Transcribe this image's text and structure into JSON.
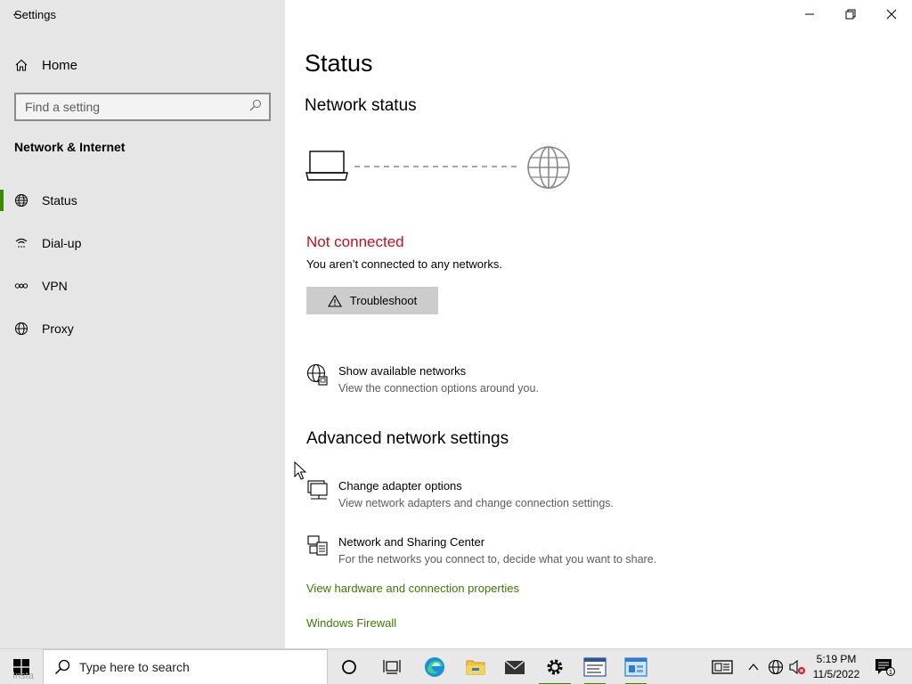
{
  "window": {
    "title": "Settings",
    "min_glyph": "—",
    "max_glyph": "❐",
    "close_glyph": "✕"
  },
  "sidebar": {
    "home_label": "Home",
    "search_placeholder": "Find a setting",
    "section_title": "Network & Internet",
    "items": [
      {
        "label": "Status",
        "icon": "globe-icon",
        "active": true
      },
      {
        "label": "Dial-up",
        "icon": "dialup-icon",
        "active": false
      },
      {
        "label": "VPN",
        "icon": "vpn-icon",
        "active": false
      },
      {
        "label": "Proxy",
        "icon": "globe-icon",
        "active": false
      }
    ]
  },
  "main": {
    "title": "Status",
    "network_status_heading": "Network status",
    "status": "Not connected",
    "status_color": "#c50f1f",
    "status_description": "You aren’t connected to any networks.",
    "troubleshoot_label": "Troubleshoot",
    "show_networks": {
      "title": "Show available networks",
      "description": "View the connection options around you."
    },
    "advanced_heading": "Advanced network settings",
    "adapter": {
      "title": "Change adapter options",
      "description": "View network adapters and change connection settings."
    },
    "sharing": {
      "title": "Network and Sharing Center",
      "description": "For the networks you connect to, decide what you want to share."
    },
    "link_hardware": "View hardware and connection properties",
    "link_firewall": "Windows Firewall",
    "link_color": "#3d7a00"
  },
  "taskbar": {
    "search_placeholder": "Type here to search",
    "install_text": "Insta",
    "time": "5:19 PM",
    "date": "11/5/2022",
    "notification_count": "1",
    "accent": "#3a8a00"
  }
}
